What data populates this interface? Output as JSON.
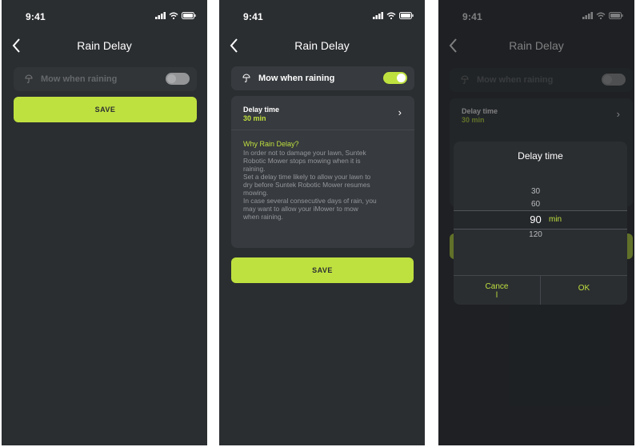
{
  "status": {
    "time": "9:41"
  },
  "nav": {
    "title": "Rain Delay"
  },
  "toggle": {
    "label": "Mow when raining"
  },
  "save": {
    "label": "SAVE"
  },
  "delay": {
    "label": "Delay time",
    "value": "30 min"
  },
  "why": {
    "title": "Why Rain Delay?",
    "body": [
      "In order not to damage your lawn, Suntek",
      "Robotic Mower stops mowing when it is",
      "raining.",
      "Set a delay time likely to allow your lawn to",
      "dry before Suntek Robotic Mower resumes",
      "mowing.",
      "In case several consecutive days of rain, you",
      " may want to allow your iMower to mow",
      "when raining."
    ]
  },
  "picker": {
    "title": "Delay time",
    "options": [
      "30",
      "60",
      "90",
      "120"
    ],
    "selected": "90",
    "unit": "min",
    "cancel_label": "Cance\nl",
    "ok_label": "OK"
  },
  "colors": {
    "accent": "#bfe13f",
    "background": "#2b2e31",
    "card": "#373a3e"
  },
  "screens": [
    {
      "toggle_on": false
    },
    {
      "toggle_on": true
    },
    {
      "toggle_on": false
    }
  ]
}
